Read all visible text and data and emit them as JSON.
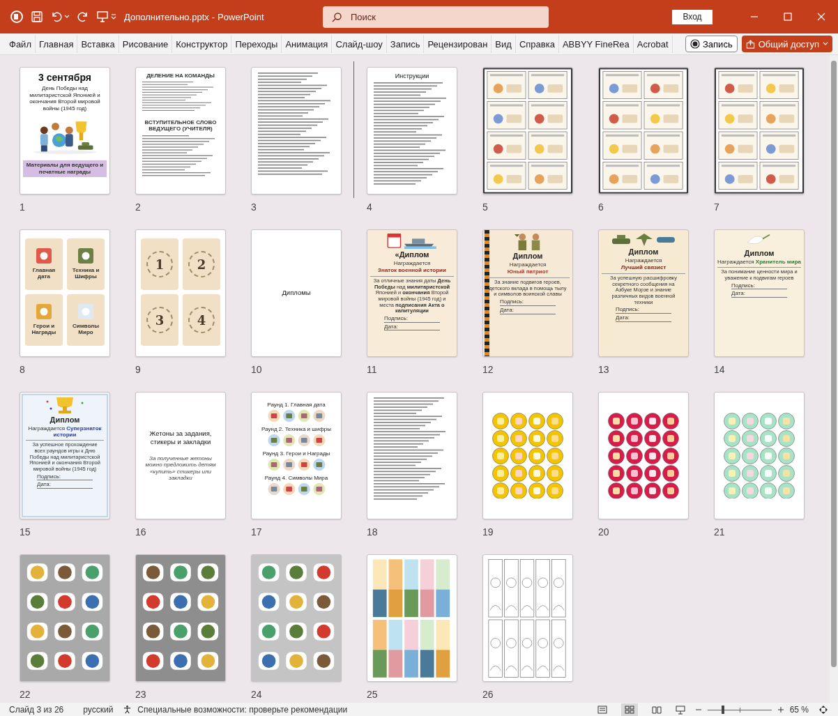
{
  "title_bar": {
    "file_name": "Дополнительно.pptx",
    "separator": "-",
    "app_name": "PowerPoint",
    "search": {
      "placeholder": "Поиск"
    },
    "sign_in": "Вход"
  },
  "ribbon_tabs": [
    "Файл",
    "Главная",
    "Вставка",
    "Рисование",
    "Конструктор",
    "Переходы",
    "Анимация",
    "Слайд-шоу",
    "Запись",
    "Рецензирован",
    "Вид",
    "Справка",
    "ABBYY FineRea",
    "Acrobat"
  ],
  "record_button": "Запись",
  "share_button": "Общий доступ",
  "slides": [
    {
      "number": "1",
      "kind": "cover",
      "title": "3 сентября",
      "subtitle": "День Победы над милитаристской Японией и окончания Второй мировой войны (1945 год)",
      "banner": "Материалы для ведущего и печатные награды"
    },
    {
      "number": "2",
      "kind": "document",
      "headings": [
        "ДЕЛЕНИЕ НА КОМАНДЫ",
        "ВСТУПИТЕЛЬНОЕ СЛОВО ВЕДУЩЕГО (УЧИТЕЛЯ)"
      ]
    },
    {
      "number": "3",
      "kind": "document"
    },
    {
      "number": "4",
      "kind": "document",
      "title": "Инструкции"
    },
    {
      "number": "5",
      "kind": "card_grid"
    },
    {
      "number": "6",
      "kind": "card_grid"
    },
    {
      "number": "7",
      "kind": "card_grid"
    },
    {
      "number": "8",
      "kind": "draw_cards",
      "cards": [
        "Главная дата",
        "Техника и Шифры",
        "Герои и Награды",
        "Символы Миро"
      ]
    },
    {
      "number": "9",
      "kind": "number_cards",
      "cards": [
        "1",
        "2",
        "3",
        "4"
      ]
    },
    {
      "number": "10",
      "kind": "section",
      "title": "Дипломы"
    },
    {
      "number": "11",
      "kind": "diploma",
      "picture": {
        "kind": "calendar_ship"
      },
      "title": "«Диплом",
      "awarded": "Награждается",
      "award": {
        "text": "Знаток военной истории",
        "color": "#8a2a24"
      },
      "award_inline": false,
      "body": "За отличные знания даты **День Победы** над **милитаристской** Японией и **окончания** Второй мировой войны (1945 год) и места **подписания Акта о капитуляции**",
      "signature": "Подпись:",
      "date": "Дата:"
    },
    {
      "number": "12",
      "kind": "diploma",
      "picture": {
        "kind": "kids"
      },
      "title": "Диплом",
      "awarded": "Награждается",
      "award": {
        "text": "Юный патриот",
        "color": "#b3372c"
      },
      "award_inline": false,
      "body": "За знание подвигов героев, детского вклада в помощь тылу и символов воинской славы",
      "signature": "Подпись:",
      "date": "Дата:"
    },
    {
      "number": "13",
      "kind": "diploma",
      "picture": {
        "kind": "vehicles"
      },
      "title": "Диплом",
      "awarded": "Награждается",
      "award": {
        "text": "Лучший связист",
        "color": "#7a2b20"
      },
      "award_inline": false,
      "body": "За успешную расшифровку секретного сообщения на Азбуке Морзе и знание различных видов военной техники",
      "signature": "Подпись:",
      "date": "Дата:"
    },
    {
      "number": "14",
      "kind": "diploma",
      "picture": {
        "kind": "dove"
      },
      "title": "Диплом",
      "awarded": "Награждается",
      "award": {
        "text": "Хранитель мира",
        "color": "#2f7d2f"
      },
      "award_inline": true,
      "body": "За понимание ценности мира и уважение к подвигам героев",
      "signature": "Подпись:",
      "date": "Дата:"
    },
    {
      "number": "15",
      "kind": "diploma",
      "picture": {
        "kind": "trophy"
      },
      "title": "Диплом",
      "awarded": "Награждается",
      "award": {
        "text": "Суперзнаток истории",
        "color": "#2b3aa8"
      },
      "award_inline": true,
      "body": "За успешное прохождение всех раундов игры к Дню Победы над милитаристской Японией и окончания Второй мировой войны (1945 год)",
      "signature": "Подпись:",
      "date": "Дата:"
    },
    {
      "number": "16",
      "kind": "section",
      "title": "Жетоны за задания, стикеры и закладки",
      "subtitle": "За полученные жетоны можно предложить детям «купить» стикеры или закладки"
    },
    {
      "number": "17",
      "kind": "rounds",
      "rounds": [
        "Раунд 1. Главная дата",
        "Раунд 2. Техника и шифры",
        "Раунд 3. Герои и Награды",
        "Раунд 4. Символы Мира"
      ]
    },
    {
      "number": "18",
      "kind": "document"
    },
    {
      "number": "19",
      "kind": "tokens",
      "color": "#f5c400"
    },
    {
      "number": "20",
      "kind": "tokens",
      "color": "#d81c4a"
    },
    {
      "number": "21",
      "kind": "tokens",
      "color": "#a8e3c8"
    },
    {
      "number": "22",
      "kind": "stickers",
      "color": "#a9a9a9"
    },
    {
      "number": "23",
      "kind": "stickers",
      "color": "#8e8e8e"
    },
    {
      "number": "24",
      "kind": "stickers",
      "color": "#c4c4c4"
    },
    {
      "number": "25",
      "kind": "bookmarks"
    },
    {
      "number": "26",
      "kind": "coloring"
    }
  ],
  "status_bar": {
    "slide_info": "Слайд 3 из 26",
    "language": "русский",
    "accessibility": "Специальные возможности: проверьте рекомендации",
    "zoom": "65 %",
    "zoom_slider": {
      "level": 0.24
    }
  }
}
